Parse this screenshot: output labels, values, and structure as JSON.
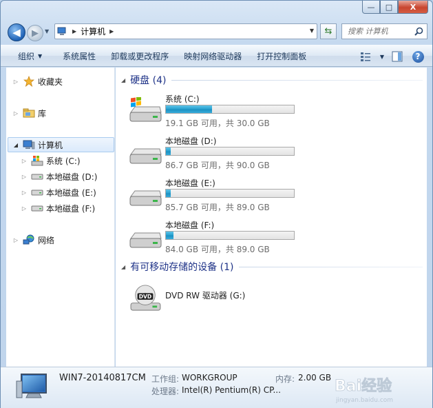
{
  "window": {
    "title": "",
    "caption": {
      "minimize": "—",
      "maximize": "□",
      "close": "X"
    }
  },
  "address": {
    "path": "计算机"
  },
  "search": {
    "placeholder": "搜索 计算机"
  },
  "toolbar": {
    "organize": "组织",
    "system_properties": "系统属性",
    "uninstall": "卸载或更改程序",
    "map_drive": "映射网络驱动器",
    "control_panel": "打开控制面板"
  },
  "nav": {
    "favorites": "收藏夹",
    "libraries": "库",
    "computer": "计算机",
    "drives": [
      "系统 (C:)",
      "本地磁盘 (D:)",
      "本地磁盘 (E:)",
      "本地磁盘 (F:)"
    ],
    "network": "网络"
  },
  "content": {
    "hard_disks_header": "硬盘 (4)",
    "drives": [
      {
        "name": "系统 (C:)",
        "info": "19.1 GB 可用，共 30.0 GB",
        "used_fraction": 0.36
      },
      {
        "name": "本地磁盘 (D:)",
        "info": "86.7 GB 可用，共 90.0 GB",
        "used_fraction": 0.04
      },
      {
        "name": "本地磁盘 (E:)",
        "info": "85.7 GB 可用，共 89.0 GB",
        "used_fraction": 0.04
      },
      {
        "name": "本地磁盘 (F:)",
        "info": "84.0 GB 可用，共 89.0 GB",
        "used_fraction": 0.06
      }
    ],
    "removable_header": "有可移动存储的设备 (1)",
    "dvd": {
      "name": "DVD RW 驱动器 (G:)",
      "badge": "DVD"
    }
  },
  "status": {
    "computer_name": "WIN7-20140817CM",
    "workgroup_label": "工作组:",
    "workgroup_value": "WORKGROUP",
    "memory_label": "内存:",
    "memory_value": "2.00 GB",
    "processor_label": "处理器:",
    "processor_value": "Intel(R) Pentium(R) CP..."
  },
  "watermark": {
    "text": "Bai经验",
    "url": "jingyan.baidu.com"
  },
  "colors": {
    "accent": "#1e3287",
    "bar_fill": "#27a0cf",
    "selection": "#dbeafc"
  }
}
